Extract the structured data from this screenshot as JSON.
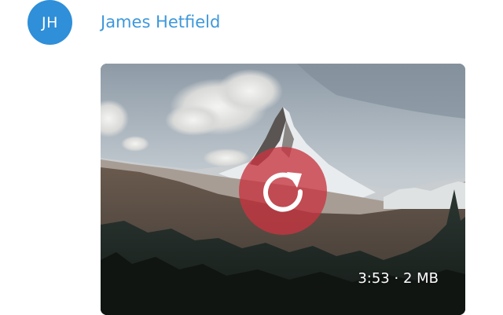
{
  "message": {
    "avatar_initials": "JH",
    "avatar_color": "#2f8fd8",
    "author_name": "James Hetfield",
    "author_color": "#3e98db"
  },
  "media": {
    "type": "video",
    "thumbnail": "mountain-landscape",
    "overlay_icon": "reload-icon",
    "overlay_color": "#c83440",
    "duration": "3:53",
    "separator": "·",
    "size": "2 MB"
  }
}
